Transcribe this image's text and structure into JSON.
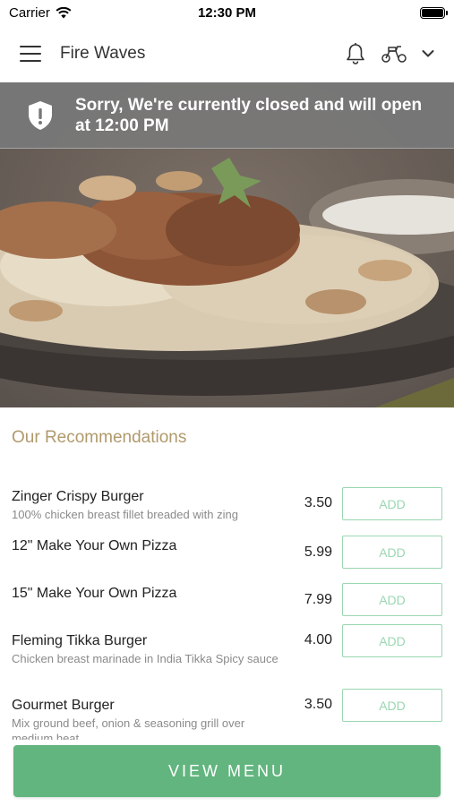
{
  "status_bar": {
    "carrier": "Carrier",
    "time": "12:30 PM"
  },
  "header": {
    "title": "Fire Waves",
    "icons": [
      "menu-icon",
      "bell-icon",
      "scooter-icon",
      "chevron-down-icon"
    ]
  },
  "banner": {
    "message": "Sorry, We're currently closed and will open at 12:00 PM",
    "icon": "shield-alert-icon"
  },
  "recommendations": {
    "title": "Our Recommendations",
    "add_label": "ADD",
    "items": [
      {
        "name": "Zinger Crispy Burger",
        "description": "100% chicken breast fillet breaded with zing",
        "price": "3.50"
      },
      {
        "name": "12\" Make Your Own Pizza",
        "description": "",
        "price": "5.99"
      },
      {
        "name": "15\" Make Your Own Pizza",
        "description": "",
        "price": "7.99"
      },
      {
        "name": "Fleming Tikka Burger",
        "description": "Chicken breast marinade in India Tikka Spicy sauce",
        "price": "4.00"
      },
      {
        "name": "Gourmet Burger",
        "description": "Mix ground beef, onion & seasoning grill over medium heat",
        "price": "3.50"
      }
    ]
  },
  "footer": {
    "button_label": "VIEW MENU"
  },
  "colors": {
    "accent_green": "#62b57e",
    "add_border": "#9ad7b0",
    "section_title": "#b09a6c",
    "banner_bg": "#787878"
  }
}
